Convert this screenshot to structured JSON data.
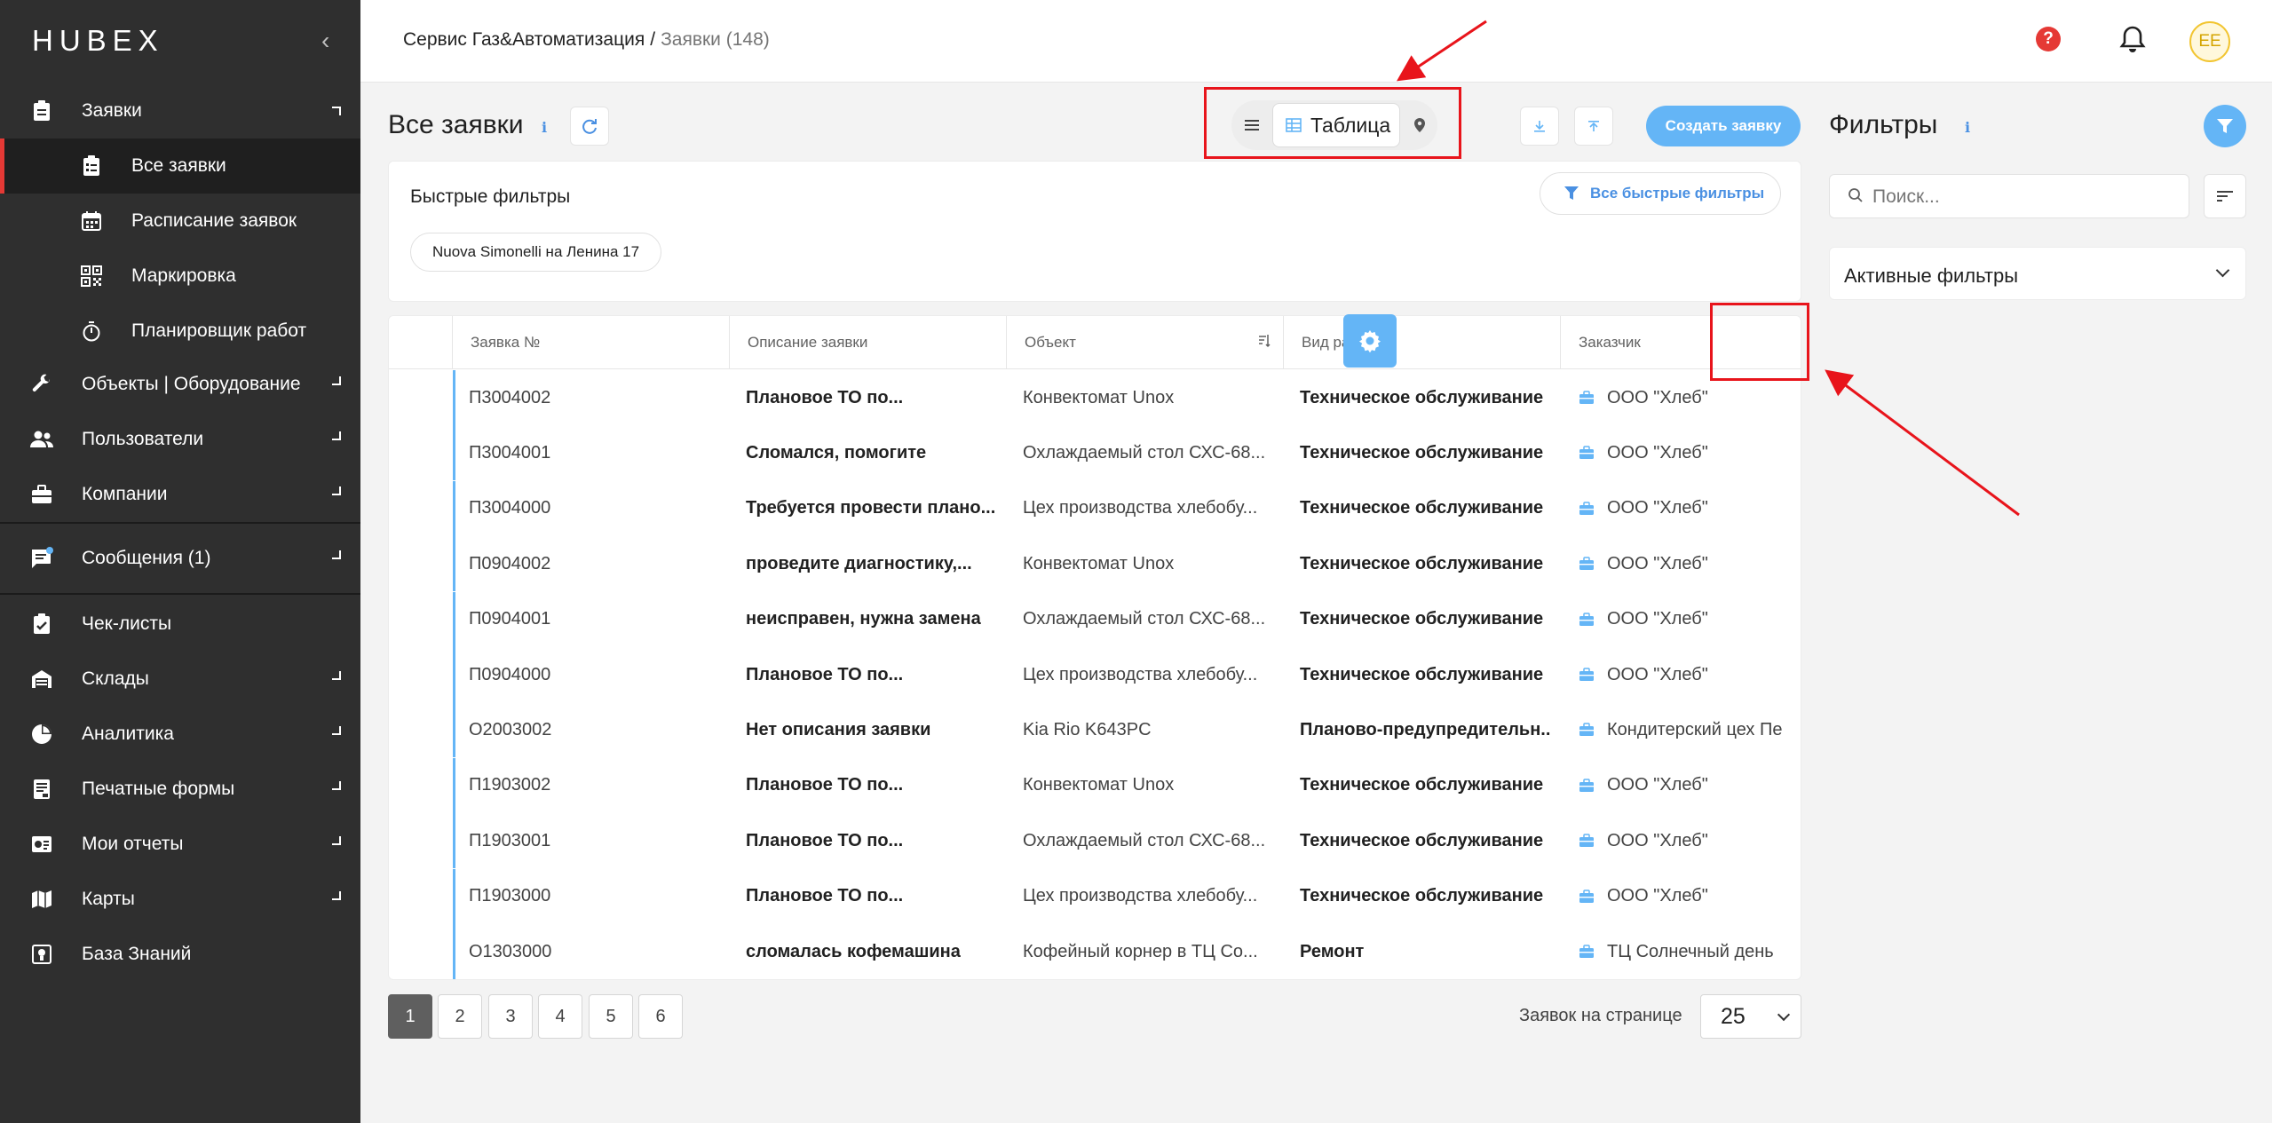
{
  "app": {
    "logo": "HUBEX"
  },
  "breadcrumb": {
    "parent": "Сервис Газ&Автоматизация",
    "separator": "/",
    "current": "Заявки (148)"
  },
  "topbar": {
    "avatar_initials": "EE",
    "help_glyph": "?"
  },
  "sidebar": {
    "items": [
      {
        "label": "Заявки",
        "icon": "clipboard-icon"
      },
      {
        "label": "Все заявки",
        "icon": "clipboard-list-icon"
      },
      {
        "label": "Расписание заявок",
        "icon": "calendar-icon"
      },
      {
        "label": "Маркировка",
        "icon": "qr-code-icon"
      },
      {
        "label": "Планировщик работ",
        "icon": "timer-icon"
      },
      {
        "label": "Объекты | Оборудование",
        "icon": "wrench-icon"
      },
      {
        "label": "Пользователи",
        "icon": "users-icon"
      },
      {
        "label": "Компании",
        "icon": "briefcase-icon"
      },
      {
        "label": "Сообщения (1)",
        "icon": "chat-icon"
      },
      {
        "label": "Чек-листы",
        "icon": "checklist-icon"
      },
      {
        "label": "Склады",
        "icon": "warehouse-icon"
      },
      {
        "label": "Аналитика",
        "icon": "pie-chart-icon"
      },
      {
        "label": "Печатные формы",
        "icon": "print-form-icon"
      },
      {
        "label": "Мои отчеты",
        "icon": "report-icon"
      },
      {
        "label": "Карты",
        "icon": "map-icon"
      },
      {
        "label": "База Знаний",
        "icon": "knowledge-icon"
      }
    ]
  },
  "main": {
    "title": "Все заявки",
    "view_switch": {
      "active_label": "Таблица"
    },
    "create_button": "Создать заявку"
  },
  "quick_filters": {
    "title": "Быстрые фильтры",
    "all_button": "Все быстрые фильтры",
    "chips": [
      "Nuova Simonelli на Ленина 17"
    ]
  },
  "table": {
    "columns": [
      "Заявка №",
      "Описание заявки",
      "Объект",
      "Вид работ",
      "Заказчик"
    ],
    "rows": [
      [
        "П3004002",
        "Плановое ТО по...",
        "Конвектомат Unox",
        "Техническое обслуживание",
        "ООО \"Хлеб\""
      ],
      [
        "П3004001",
        "Сломался, помогите",
        "Охлаждаемый стол СХС-68...",
        "Техническое обслуживание",
        "ООО \"Хлеб\""
      ],
      [
        "П3004000",
        "Требуется провести плано...",
        "Цех производства хлебобу...",
        "Техническое обслуживание",
        "ООО \"Хлеб\""
      ],
      [
        "П0904002",
        "проведите диагностику,...",
        "Конвектомат Unox",
        "Техническое обслуживание",
        "ООО \"Хлеб\""
      ],
      [
        "П0904001",
        "неисправен, нужна замена",
        "Охлаждаемый стол СХС-68...",
        "Техническое обслуживание",
        "ООО \"Хлеб\""
      ],
      [
        "П0904000",
        "Плановое ТО по...",
        "Цех производства хлебобу...",
        "Техническое обслуживание",
        "ООО \"Хлеб\""
      ],
      [
        "О2003002",
        "Нет описания заявки",
        "Kia Rio K643PC",
        "Планово-предупредительн...",
        "Кондитерский цех Пе"
      ],
      [
        "П1903002",
        "Плановое ТО по...",
        "Конвектомат Unox",
        "Техническое обслуживание",
        "ООО \"Хлеб\""
      ],
      [
        "П1903001",
        "Плановое ТО по...",
        "Охлаждаемый стол СХС-68...",
        "Техническое обслуживание",
        "ООО \"Хлеб\""
      ],
      [
        "П1903000",
        "Плановое ТО по...",
        "Цех производства хлебобу...",
        "Техническое обслуживание",
        "ООО \"Хлеб\""
      ],
      [
        "О1303000",
        "сломалась кофемашина",
        "Кофейный корнер в ТЦ Со...",
        "Ремонт",
        "ТЦ Солнечный день"
      ]
    ]
  },
  "pagination": {
    "pages": [
      "1",
      "2",
      "3",
      "4",
      "5",
      "6"
    ],
    "active_page": "1",
    "per_page_label": "Заявок на странице",
    "per_page_value": "25"
  },
  "filters_panel": {
    "title": "Фильтры",
    "search_placeholder": "Поиск...",
    "active_filters_label": "Активные фильтры"
  },
  "colors": {
    "sidebar_bg": "#2f2f2f",
    "accent_blue": "#64b5f6",
    "active_marker": "#e53935",
    "annotation_red": "#e8141b"
  }
}
